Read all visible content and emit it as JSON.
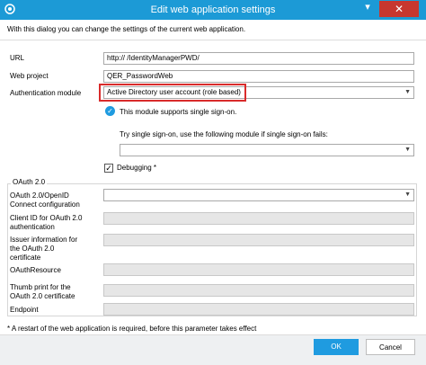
{
  "window": {
    "title": "Edit web application settings",
    "minimize_glyph": "▾",
    "close_glyph": "✕",
    "icon": "app-logo-icon"
  },
  "description": "With this dialog you can change the settings of the current web application.",
  "form": {
    "url": {
      "label": "URL",
      "value": "http://                              /IdentityManagerPWD/"
    },
    "web_project": {
      "label": "Web project",
      "value": "QER_PasswordWeb"
    },
    "auth_module": {
      "label": "Authentication module",
      "value": "Active Directory user account (role based)"
    },
    "sso_status": "This module supports single sign-on.",
    "sso_fallback_label": "Try single sign-on, use the following module if single sign-on fails:",
    "sso_fallback_value": "",
    "debugging": {
      "label": "Debugging *",
      "checked": true
    }
  },
  "oauth": {
    "group_title": "OAuth 2.0",
    "connect_config": {
      "label_line1": "OAuth 2.0/OpenID",
      "label_line2": "Connect configuration",
      "value": ""
    },
    "client_id": {
      "label_line1": "Client ID for OAuth 2.0",
      "label_line2": "authentication",
      "value": ""
    },
    "issuer": {
      "label_line1": "Issuer information for",
      "label_line2": "the OAuth 2.0",
      "label_line3": "certificate",
      "value": ""
    },
    "resource": {
      "label": "OAuthResource",
      "value": ""
    },
    "thumbprint": {
      "label_line1": "Thumb print for the",
      "label_line2": "OAuth 2.0 certificate",
      "value": ""
    },
    "endpoint": {
      "label": "Endpoint",
      "value": ""
    }
  },
  "restart_note": "* A restart of the web application is required, before this parameter takes effect",
  "buttons": {
    "ok": "OK",
    "cancel": "Cancel"
  },
  "colors": {
    "titlebar": "#1c9ad6",
    "accent": "#1f9be0",
    "highlight": "#d92b2b",
    "close": "#c7372f"
  }
}
